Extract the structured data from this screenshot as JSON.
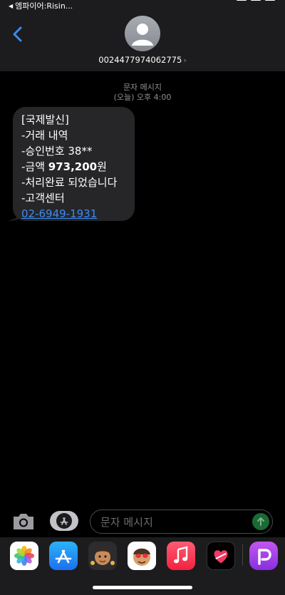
{
  "status_bar": {
    "back_label": "엠파이어:Risin..."
  },
  "header": {
    "contact_number": "0024477974062775",
    "chevron": "›"
  },
  "thread": {
    "message_type": "문자 메시지",
    "timestamp": "(오늘) 오후 4:00",
    "message": {
      "line1": "[국제발신]",
      "line2": "-거래 내역",
      "line3": "-승인번호 38**",
      "line4_prefix": "-금액 ",
      "line4_amount": "973,200",
      "line4_suffix": "원",
      "line5": "-처리완료 되었습니다",
      "line6": "-고객센터",
      "phone_link": "02-6949-1931"
    }
  },
  "input_bar": {
    "placeholder": "문자 메시지"
  },
  "app_drawer": {
    "apps": [
      "photos-icon",
      "app-store-icon",
      "memoji-icon",
      "animoji-icon",
      "music-icon",
      "heart-icon",
      "picsart-icon"
    ]
  },
  "colors": {
    "accent": "#3b8cf7",
    "bubble": "#262628",
    "send": "#1a6a34"
  }
}
